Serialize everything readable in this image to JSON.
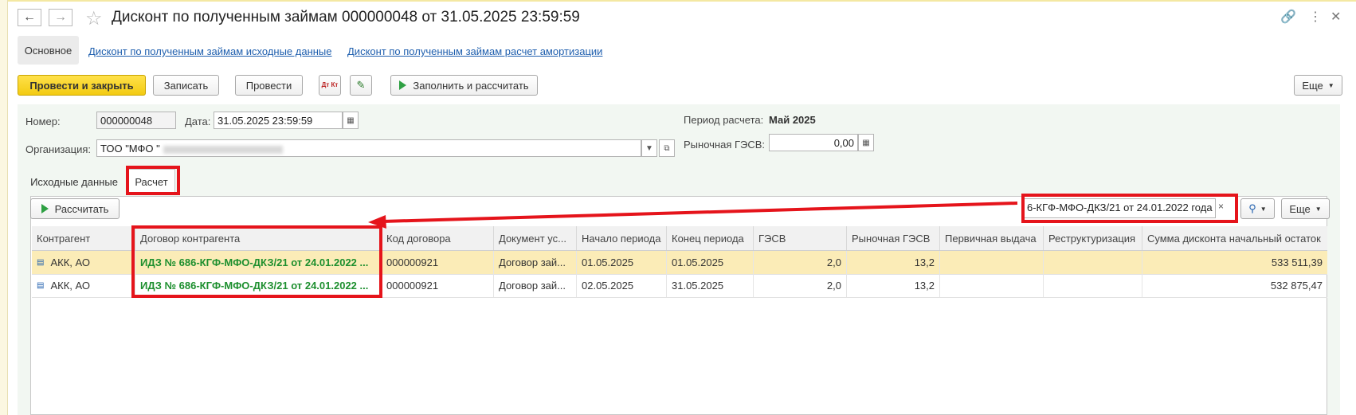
{
  "header": {
    "title": "Дисконт по полученным займам 000000048 от 31.05.2025 23:59:59",
    "back_icon": "arrow-left-icon",
    "forward_icon": "arrow-right-icon"
  },
  "tabs": [
    {
      "label": "Основное",
      "active": true
    },
    {
      "label": "Дисконт по полученным займам исходные данные"
    },
    {
      "label": "Дисконт по полученным займам расчет амортизации"
    }
  ],
  "toolbar": {
    "post_close": "Провести и закрыть",
    "save": "Записать",
    "post": "Провести",
    "dt_kt": "Дт Кт",
    "fill_calc": "Заполнить и рассчитать",
    "more": "Еще"
  },
  "form": {
    "number_label": "Номер:",
    "number": "000000048",
    "date_label": "Дата:",
    "date": "31.05.2025 23:59:59",
    "org_label": "Организация:",
    "org": "ТОО \"МФО \"",
    "period_label": "Период расчета:",
    "period": "Май 2025",
    "market_label": "Рыночная ГЭСВ:",
    "market": "0,00"
  },
  "subtabs": [
    {
      "label": "Исходные данные"
    },
    {
      "label": "Расчет",
      "active": true
    }
  ],
  "table_toolbar": {
    "calc": "Рассчитать",
    "search_value": "6-КГФ-МФО-ДКЗ/21 от 24.01.2022 года",
    "more": "Еще"
  },
  "table": {
    "columns": [
      "Контрагент",
      "Договор контрагента",
      "Код договора",
      "Документ ус...",
      "Начало периода",
      "Конец периода",
      "ГЭСВ",
      "Рыночная ГЭСВ",
      "Первичная выдача",
      "Реструктуризация",
      "Сумма дисконта начальный остаток"
    ],
    "rows": [
      [
        "АКК, АО",
        "ИДЗ № 686-КГФ-МФО-ДКЗ/21 от 24.01.2022 ...",
        "000000921",
        "Договор зай...",
        "01.05.2025",
        "01.05.2025",
        "2,0",
        "13,2",
        "",
        "",
        "533 511,39"
      ],
      [
        "АКК, АО",
        "ИДЗ № 686-КГФ-МФО-ДКЗ/21 от 24.01.2022 ...",
        "000000921",
        "Договор зай...",
        "02.05.2025",
        "31.05.2025",
        "2,0",
        "13,2",
        "",
        "",
        "532 875,47"
      ]
    ]
  },
  "colors": {
    "accent_red": "#e5141b",
    "primary_yellow": "#f3cb12",
    "selected_row": "#fbecb7",
    "contract_green": "#1d8f2e"
  }
}
